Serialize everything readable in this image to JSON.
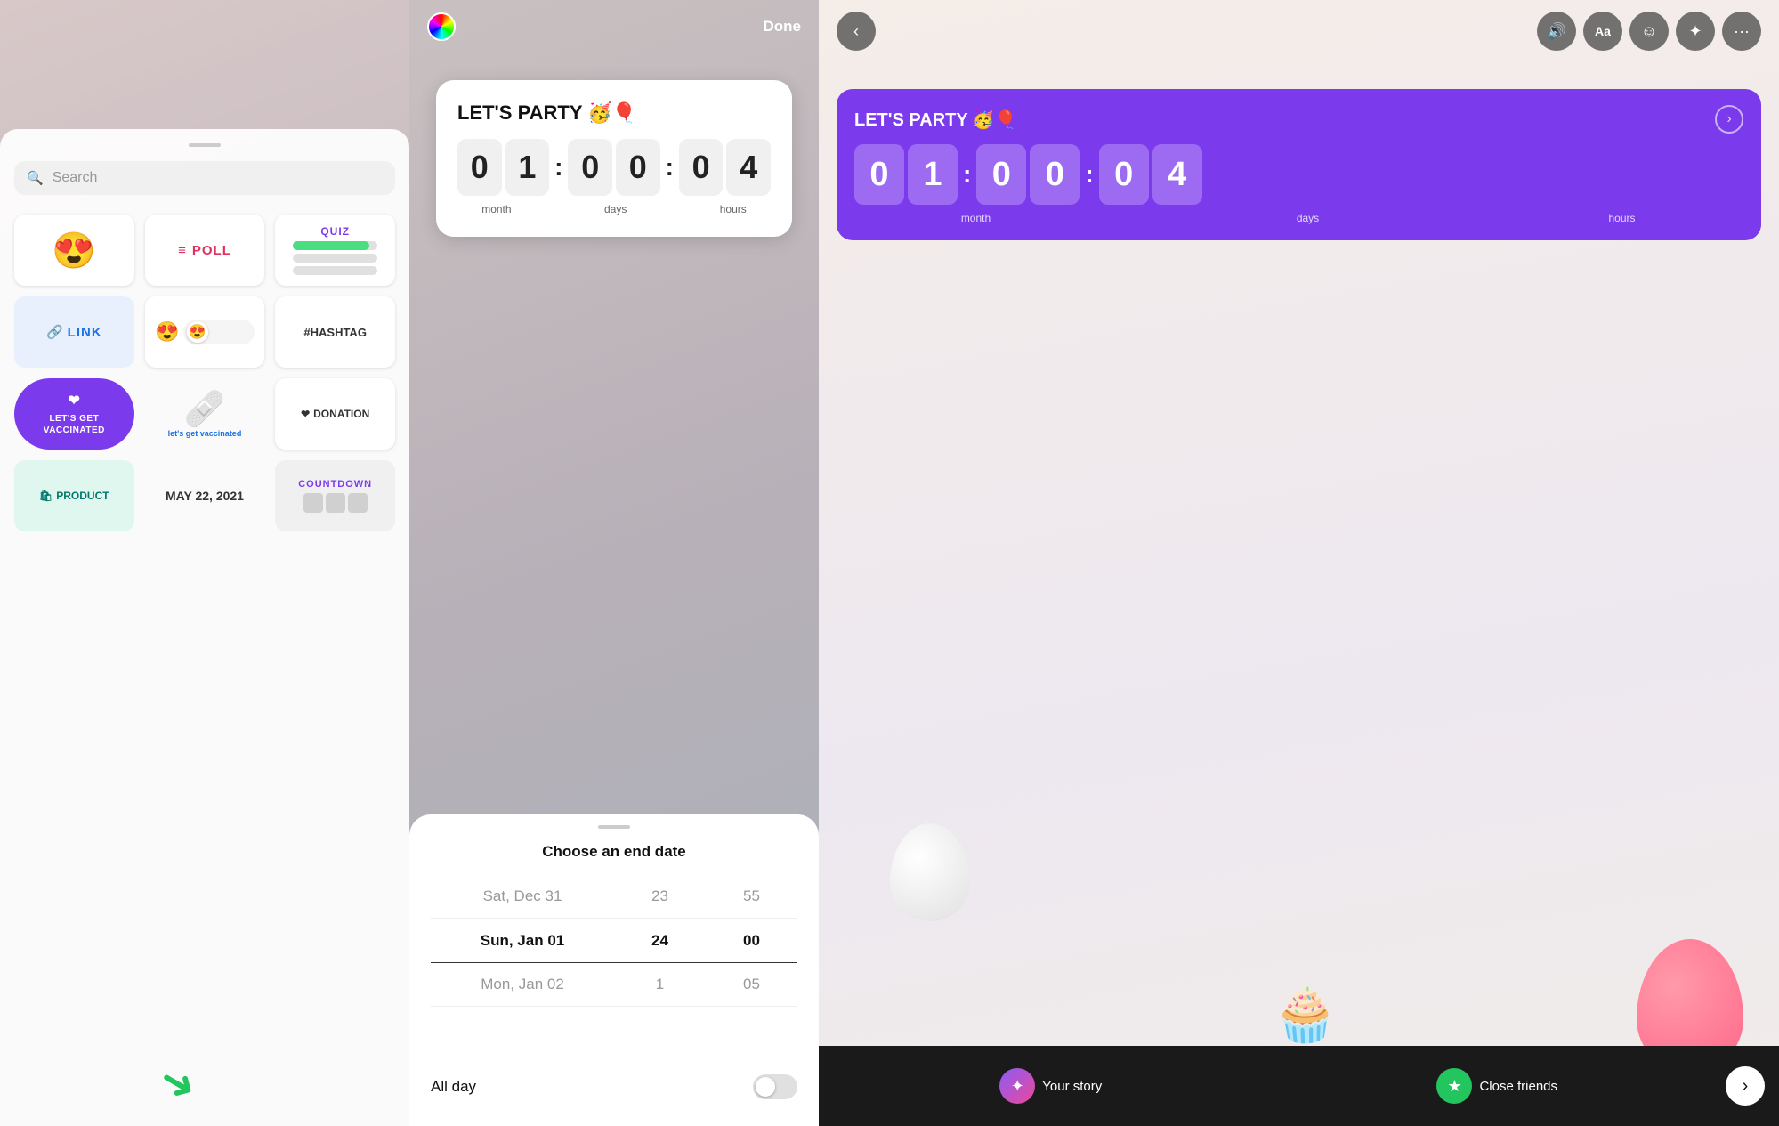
{
  "panel1": {
    "search_placeholder": "Search",
    "stickers": [
      {
        "id": "emoji",
        "emoji": "😍"
      },
      {
        "id": "poll",
        "label": "≡ POLL"
      },
      {
        "id": "quiz",
        "label": "QUIZ"
      },
      {
        "id": "link",
        "label": "🔗 LINK"
      },
      {
        "id": "emoji_slider",
        "emoji": "😍"
      },
      {
        "id": "hashtag",
        "label": "#HASHTAG"
      },
      {
        "id": "vaccinated",
        "label": "LET'S GET VACCINATED"
      },
      {
        "id": "bandage",
        "label": "let's get vaccinated"
      },
      {
        "id": "donation",
        "label": "❤ DONATION"
      },
      {
        "id": "product",
        "label": "🛍 PRODUCT"
      },
      {
        "id": "date",
        "label": "MAY 22, 2021"
      },
      {
        "id": "countdown",
        "label": "COUNTDOWN"
      }
    ]
  },
  "panel2": {
    "done_label": "Done",
    "countdown_title": "LET'S PARTY 🥳🎈",
    "digits": {
      "month": [
        "0",
        "1"
      ],
      "days": [
        "0",
        "0"
      ],
      "hours": [
        "0",
        "4"
      ],
      "labels": [
        "month",
        "days",
        "hours"
      ]
    },
    "date_picker": {
      "title": "Choose an end date",
      "rows": [
        {
          "date": "Sat, Dec 31",
          "hour": "23",
          "minute": "55"
        },
        {
          "date": "Sun, Jan 01",
          "hour": "24",
          "minute": "00"
        },
        {
          "date": "Mon, Jan 02",
          "hour": "1",
          "minute": "05"
        }
      ],
      "selected_index": 1,
      "all_day_label": "All day"
    }
  },
  "panel3": {
    "countdown_title": "LET'S PARTY 🥳🎈",
    "digits": {
      "values": [
        "0",
        "1",
        "0",
        "0",
        "0",
        "4"
      ],
      "labels": [
        "month",
        "days",
        "hours"
      ]
    },
    "bottom_bar": {
      "your_story_label": "Your story",
      "close_friends_label": "Close friends"
    },
    "icons": {
      "back": "‹",
      "sound": "🔊",
      "text": "Aa",
      "face": "☺",
      "sparkle": "✦",
      "more": "···",
      "next": "›"
    }
  }
}
